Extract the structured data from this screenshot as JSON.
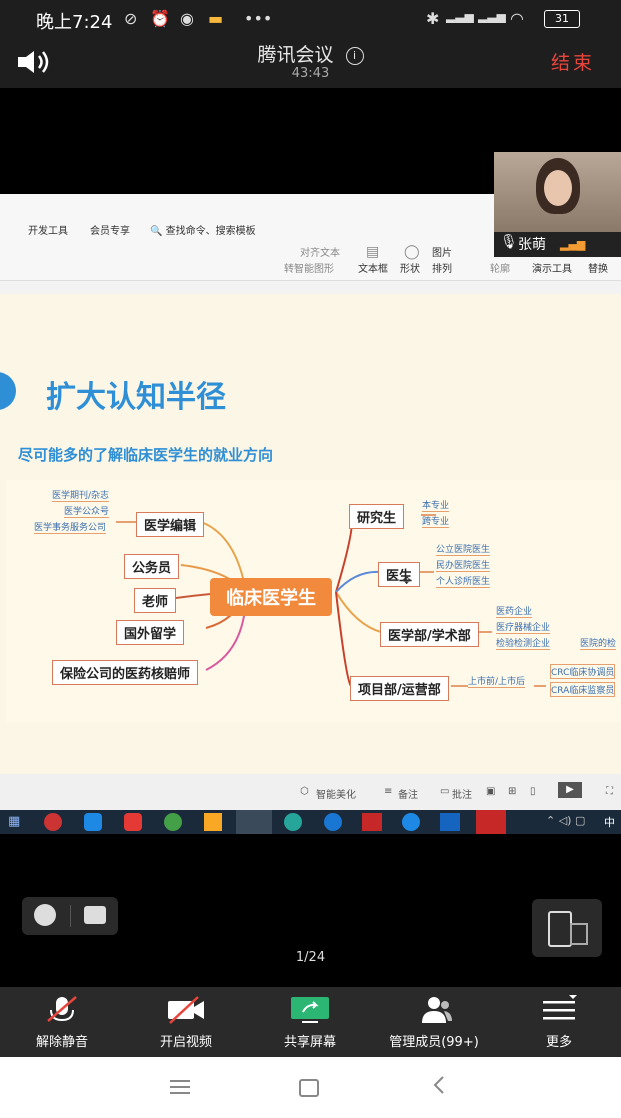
{
  "status_bar": {
    "time": "晚上7:24",
    "battery": "31"
  },
  "meeting": {
    "app_title": "腾讯会议",
    "duration": "43:43",
    "end_label": "结束"
  },
  "ribbon": {
    "tabs": [
      "开发工具",
      "会员专享",
      "查找命令、搜索模板"
    ],
    "items": [
      "对齐文本",
      "转智能图形",
      "文本框",
      "形状",
      "图片",
      "排列",
      "轮廓",
      "演示工具",
      "替换"
    ]
  },
  "slide": {
    "title": "扩大认知半径",
    "subtitle": "尽可能多的了解临床医学生的就业方向",
    "center": "临床医学生",
    "left_nodes": [
      "医学编辑",
      "公务员",
      "老师",
      "国外留学",
      "保险公司的医药核赔师"
    ],
    "left_leaves": [
      "医学期刊/杂志",
      "医学公众号",
      "医学事务服务公司"
    ],
    "right_nodes": [
      "研究生",
      "医生",
      "医学部/学术部",
      "项目部/运营部"
    ],
    "research_leaves": [
      "本专业",
      "跨专业"
    ],
    "doctor_leaves": [
      "公立医院医生",
      "民办医院医生",
      "个人诊所医生"
    ],
    "medical_leaves": [
      "医药企业",
      "医疗器械企业",
      "检验检测企业",
      "医院的检"
    ],
    "project_leaves": [
      "上市前/上市后",
      "CRC临床协调员",
      "CRA临床监察员"
    ]
  },
  "slide_footer": {
    "items": [
      "智能美化",
      "备注",
      "批注"
    ]
  },
  "taskbar": {
    "lang": "中"
  },
  "participant": {
    "name": "张萌"
  },
  "pager": {
    "text": "1/24"
  },
  "toolbar": {
    "unmute": "解除静音",
    "video": "开启视频",
    "share": "共享屏幕",
    "members": "管理成员(99+)",
    "more": "更多"
  }
}
